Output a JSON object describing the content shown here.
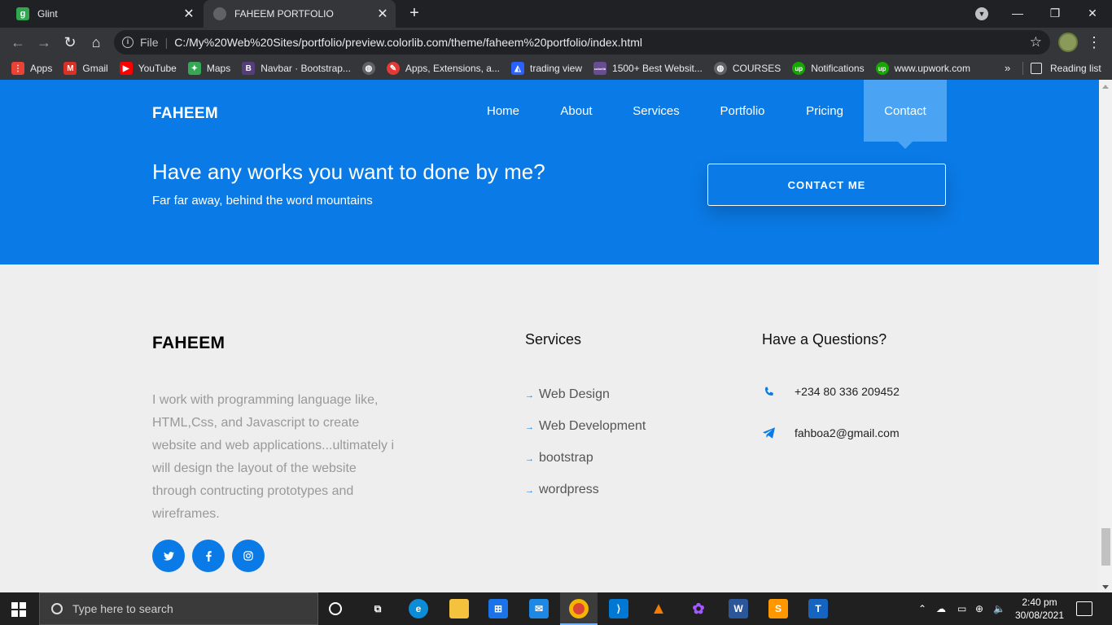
{
  "browser": {
    "tabs": [
      {
        "title": "Glint",
        "favicon_letter": "g"
      },
      {
        "title": "FAHEEM PORTFOLIO"
      }
    ],
    "omnibox": {
      "scheme_label": "File",
      "url": "C:/My%20Web%20Sites/portfolio/preview.colorlib.com/theme/faheem%20portfolio/index.html"
    },
    "bookmarks": [
      {
        "label": "Apps",
        "color": "#ea4335"
      },
      {
        "label": "Gmail",
        "color": "#d93025"
      },
      {
        "label": "YouTube",
        "color": "#ff0000"
      },
      {
        "label": "Maps",
        "color": "#34a853"
      },
      {
        "label": "Navbar · Bootstrap...",
        "color": "#563d7c",
        "letter": "B"
      },
      {
        "label": "",
        "color": "#5f6368"
      },
      {
        "label": "Apps, Extensions, a...",
        "color": "#e53935"
      },
      {
        "label": "trading view",
        "color": "#2962ff"
      },
      {
        "label": "1500+ Best Websit...",
        "color": "#6a4c93",
        "letter": "colorlib"
      },
      {
        "label": "COURSES",
        "color": "#5f6368"
      },
      {
        "label": "Notifications",
        "color": "#14a800",
        "letter": "up"
      },
      {
        "label": "www.upwork.com",
        "color": "#14a800",
        "letter": "up"
      }
    ],
    "more": "»",
    "reading_list": "Reading list"
  },
  "site": {
    "brand": "FAHEEM",
    "nav": [
      "Home",
      "About",
      "Services",
      "Portfolio",
      "Pricing",
      "Contact"
    ],
    "active_nav": "Contact",
    "cta": {
      "title": "Have any works you want to done by me?",
      "subtitle": "Far far away, behind the word mountains",
      "button": "CONTACT ME"
    },
    "footer": {
      "brand": "FAHEEM",
      "about": "I work with programming language like, HTML,Css, and Javascript to create website and web applications...ultimately i will design the layout of the website through contructing prototypes and wireframes.",
      "services_title": "Services",
      "services": [
        "Web Design",
        "Web Development",
        "bootstrap",
        "wordpress"
      ],
      "questions_title": "Have a Questions?",
      "phone": "+234 80 336 209452",
      "email": "fahboa2@gmail.com",
      "social": [
        "twitter-icon",
        "facebook-icon",
        "instagram-icon"
      ]
    },
    "accent_color": "#0a7ae6"
  },
  "taskbar": {
    "search_placeholder": "Type here to search",
    "time": "2:40 pm",
    "date": "30/08/2021"
  }
}
